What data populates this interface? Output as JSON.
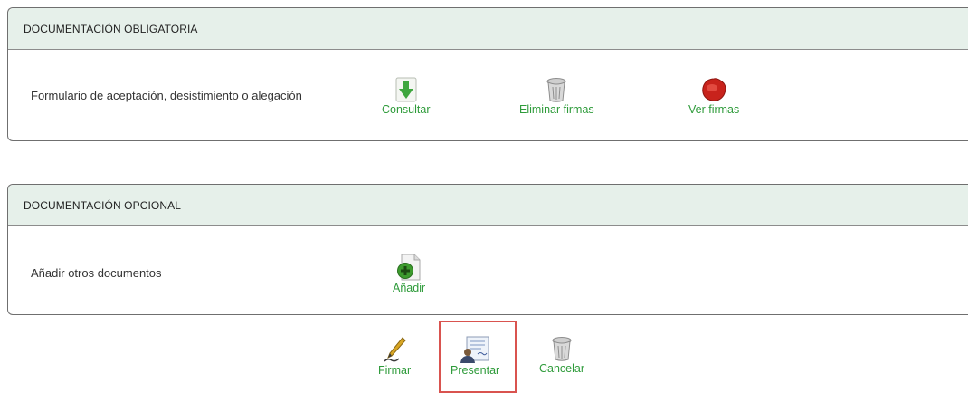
{
  "mandatory": {
    "title": "DOCUMENTACIÓN OBLIGATORIA",
    "row_label": "Formulario de aceptación, desistimiento o alegación",
    "actions": {
      "consult": {
        "label": "Consultar",
        "icon": "download-arrow-icon"
      },
      "delete_signatures": {
        "label": "Eliminar firmas",
        "icon": "trash-can-icon"
      },
      "view_signatures": {
        "label": "Ver firmas",
        "icon": "wax-seal-icon"
      }
    }
  },
  "optional": {
    "title": "DOCUMENTACIÓN OPCIONAL",
    "row_label": "Añadir otros documentos",
    "actions": {
      "add": {
        "label": "Añadir",
        "icon": "add-document-icon"
      }
    }
  },
  "footer": {
    "sign": {
      "label": "Firmar",
      "icon": "pen-icon"
    },
    "submit": {
      "label": "Presentar",
      "icon": "presenter-document-icon"
    },
    "cancel": {
      "label": "Cancelar",
      "icon": "trash-can-icon"
    }
  },
  "colors": {
    "header_bg": "#e6f0ea",
    "action_text": "#2e9b3a",
    "highlight": "#d9534f"
  }
}
